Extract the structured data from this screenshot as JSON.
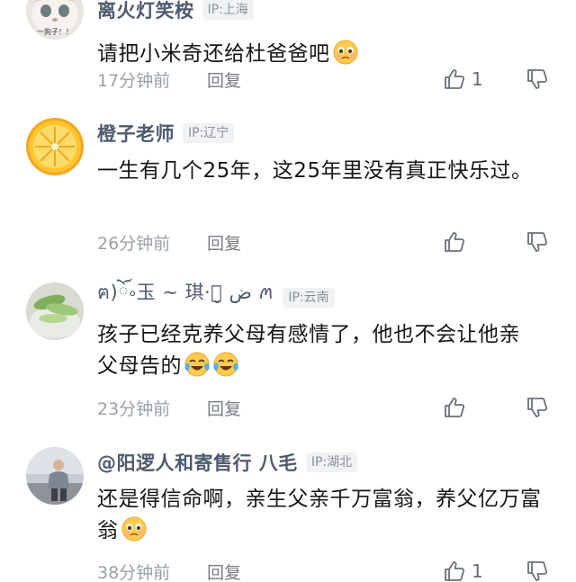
{
  "comments": [
    {
      "username": "离火灯笑桉",
      "ip": "IP:上海",
      "text": "请把小米奇还给杜爸爸吧",
      "emoji": "pleading-face",
      "time": "17分钟前",
      "reply": "回复",
      "likes": "1"
    },
    {
      "username": "橙子老师",
      "ip": "IP:辽宁",
      "text": "一生有几个25年，这25年里没有真正快乐过。",
      "time": "26分钟前",
      "reply": "回复",
      "likes": ""
    },
    {
      "username": "ฅ)ོ༚玉 ~ 琪·ꪑ̮ ض ꪔ",
      "ip": "IP:云南",
      "text": "孩子已经克养父母有感情了，他也不会让他亲父母告的",
      "emoji": "crying-laughing-face x2",
      "time": "23分钟前",
      "reply": "回复",
      "likes": ""
    },
    {
      "username": "@阳逻人和寄售行 八毛",
      "ip": "IP:湖北",
      "text": "还是得信命啊，亲生父亲千万富翁，养父亿万富翁",
      "emoji": "pleading-face",
      "time": "38分钟前",
      "reply": "回复",
      "likes": "1"
    }
  ],
  "avatar_1_caption": "一狗子！！"
}
